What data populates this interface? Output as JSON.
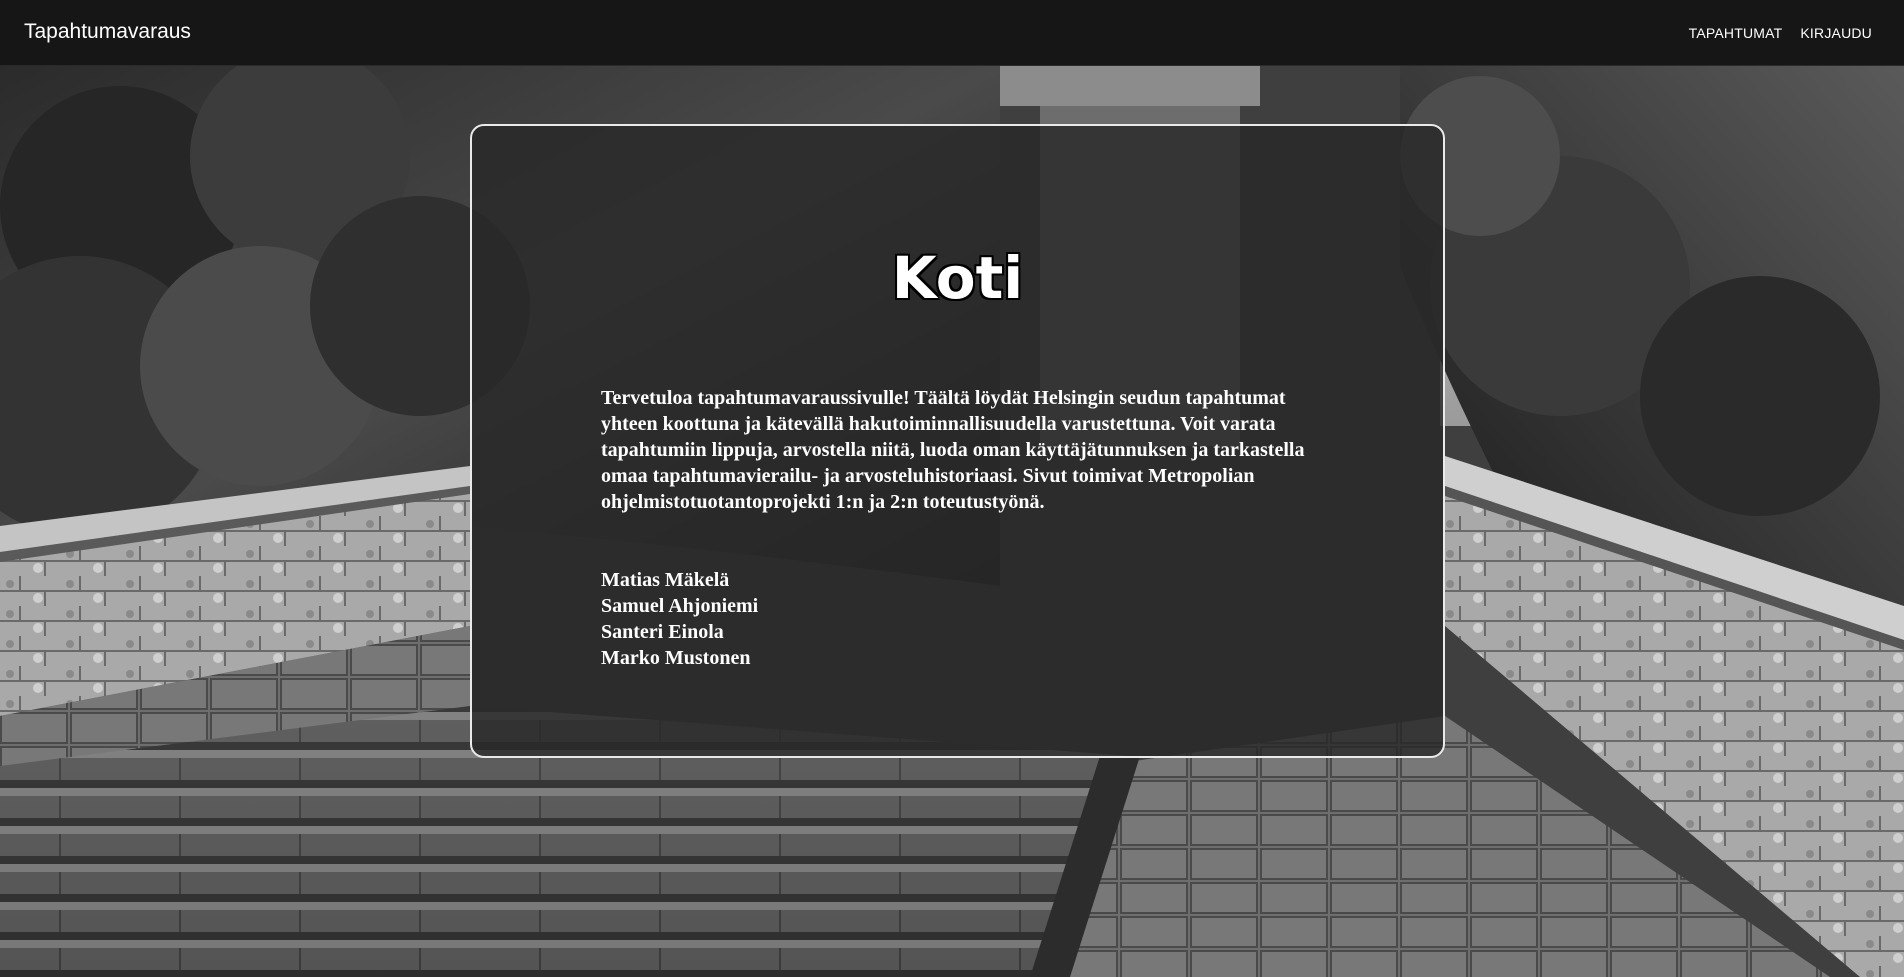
{
  "header": {
    "brand": "Tapahtumavaraus",
    "nav": [
      {
        "label": "TAPAHTUMAT"
      },
      {
        "label": "KIRJAUDU"
      }
    ]
  },
  "main": {
    "title": "Koti",
    "intro": "Tervetuloa tapahtumavaraussivulle! Täältä löydät Helsingin seudun tapahtumat yhteen koottuna ja kätevällä hakutoiminnallisuudella varustettuna. Voit varata tapahtumiin lippuja, arvostella niitä, luoda oman käyttäjätunnuksen ja tarkastella omaa tapahtumavierailu- ja arvosteluhistoriaasi. Sivut toimivat Metropolian ohjelmistotuotantoprojekti 1:n ja 2:n toteutustyönä.",
    "authors": [
      "Matias Mäkelä",
      "Samuel Ahjoniemi",
      "Santeri Einola",
      "Marko Mustonen"
    ]
  },
  "colors": {
    "navbar": "#161616",
    "card_background": "#282828",
    "card_border": "#eaeaea",
    "text": "#ffffff"
  }
}
